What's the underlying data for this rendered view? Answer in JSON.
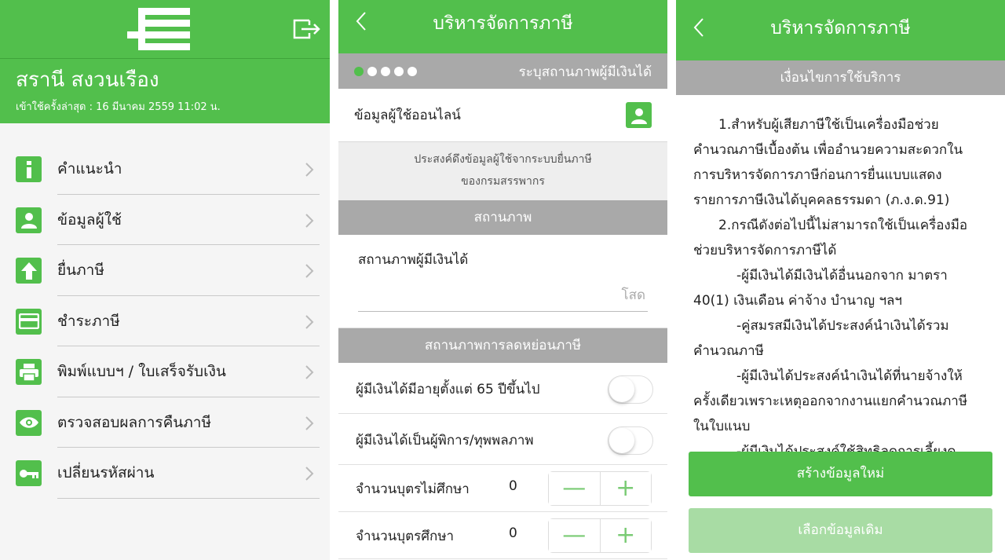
{
  "colors": {
    "accent": "#52bf4c",
    "gray_bar": "#a9a9a9",
    "light_green": "#a8dca4"
  },
  "panel1": {
    "user_name": "สรานี สงวนเรือง",
    "last_login": "เข้าใช้ครั้งล่าสุด : 16 มีนาคม 2559 11:02 น.",
    "menu": [
      {
        "label": "คำแนะนำ",
        "icon": "info-icon"
      },
      {
        "label": "ข้อมูลผู้ใช้",
        "icon": "user-icon"
      },
      {
        "label": "ยื่นภาษี",
        "icon": "upload-arrow-icon"
      },
      {
        "label": "ชำระภาษี",
        "icon": "credit-card-icon"
      },
      {
        "label": "พิมพ์แบบฯ / ใบเสร็จรับเงิน",
        "icon": "printer-icon"
      },
      {
        "label": "ตรวจสอบผลการคืนภาษี",
        "icon": "eye-icon"
      },
      {
        "label": "เปลี่ยนรหัสผ่าน",
        "icon": "key-icon"
      }
    ]
  },
  "panel2": {
    "title": "บริหารจัดการภาษี",
    "steps": {
      "total": 5,
      "current": 1,
      "label": "ระบุสถานภาพผู้มีเงินได้"
    },
    "online_info_label": "ข้อมูลผู้ใช้ออนไลน์",
    "note_line1": "ประสงค์ดึงข้อมูลผู้ใช้จากระบบยื่นภาษี",
    "note_line2": "ของกรมสรรพากร",
    "section_status": "สถานภาพ",
    "status_label": "สถานภาพผู้มีเงินได้",
    "status_value": "โสด",
    "section_reduction": "สถานภาพการลดหย่อนภาษี",
    "toggles": [
      {
        "label": "ผู้มีเงินได้มีอายุตั้งแต่ 65 ปีขึ้นไป",
        "on": false
      },
      {
        "label": "ผู้มีเงินได้เป็นผู้พิการ/ทุพพลภาพ",
        "on": false
      }
    ],
    "counters": [
      {
        "label": "จำนวนบุตรไม่ศึกษา",
        "value": "0"
      },
      {
        "label": "จำนวนบุตรศึกษา",
        "value": "0"
      }
    ],
    "minus": "—",
    "plus": "+"
  },
  "panel3": {
    "title": "บริหารจัดการภาษี",
    "subtitle": "เงื่อนไขการใช้บริการ",
    "terms": [
      "1.สำหรับผู้เสียภาษีใช้เป็นเครื่องมือช่วย",
      "คำนวณภาษีเบื้องต้น เพื่ออำนวยความสะดวกใน",
      "การบริหารจัดการภาษีก่อนการยื่นแบบแสดง",
      "รายการภาษีเงินได้บุคคลธรรมดา (ภ.ง.ด.91)",
      "2.กรณีดังต่อไปนี้ไม่สามารถใช้เป็นเครื่องมือ",
      "ช่วยบริหารจัดการภาษีได้",
      "-ผู้มีเงินได้มีเงินได้อื่นนอกจาก มาตรา",
      "40(1) เงินเดือน ค่าจ้าง บำนาญ ฯลฯ",
      "-คู่สมรสมีเงินได้ประสงค์นำเงินได้รวม",
      "คำนวณภาษี",
      "-ผู้มีเงินได้ประสงค์นำเงินได้ที่นายจ้างให้",
      "ครั้งเดียวเพราะเหตุออกจากงานแยกคำนวณภาษี",
      "ในใบแนบ",
      "-ผู้มีเงินได้ประสงค์ใช้สิทธิลดการเลี้ยงดู"
    ],
    "btn_new": "สร้างข้อมูลใหม่",
    "btn_existing": "เลือกข้อมูลเดิม"
  }
}
